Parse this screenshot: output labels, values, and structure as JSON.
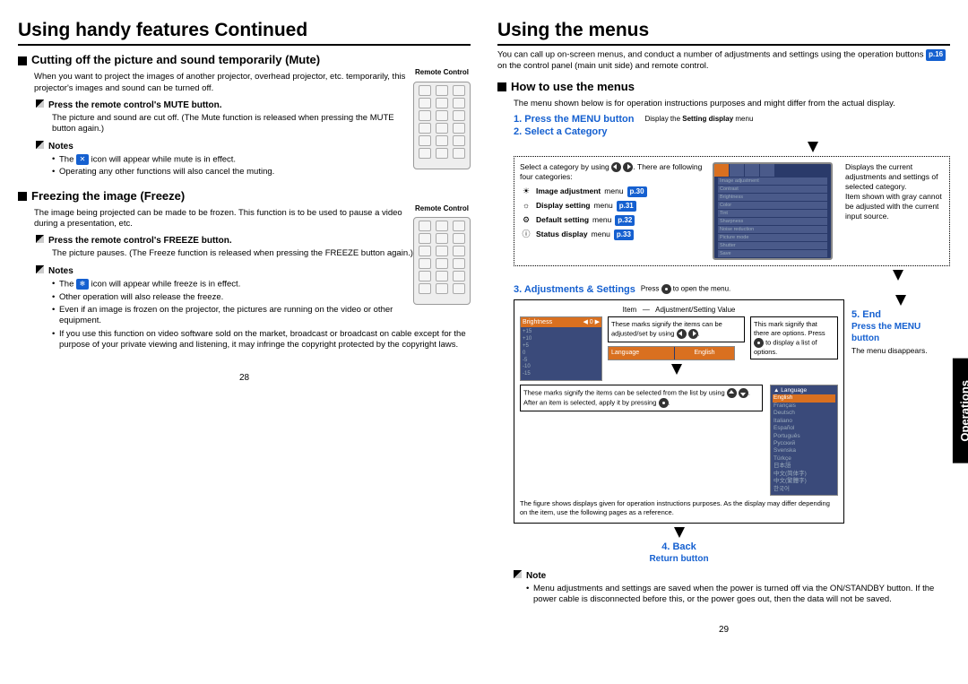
{
  "left": {
    "title": "Using handy features Continued",
    "mute": {
      "heading": "Cutting off the picture and sound temporarily (Mute)",
      "intro": "When you want to project the images of another projector, overhead projector, etc. temporarily, this projector's images and sound can be turned off.",
      "remote_label": "Remote Control",
      "step1": "Press the remote control's MUTE button.",
      "step1_desc": "The picture and sound are cut off. (The Mute function is released when pressing the MUTE button again.)",
      "notes_label": "Notes",
      "note1a": "The ",
      "note1b": " icon will appear while mute is in effect.",
      "note2": "Operating any other functions will also cancel the muting."
    },
    "freeze": {
      "heading": "Freezing the image (Freeze)",
      "intro": "The image being projected can be made to be frozen. This function is to be used to pause a video during a presentation, etc.",
      "remote_label": "Remote Control",
      "step1": "Press the remote control's FREEZE button.",
      "step1_desc": "The picture pauses. (The Freeze function is released when pressing the FREEZE button again.)",
      "notes_label": "Notes",
      "note1a": "The ",
      "note1b": " icon will appear while freeze is in effect.",
      "note2": "Other operation will also release the freeze.",
      "note3": "Even if an image is frozen on the projector, the pictures are running on the video or other equipment.",
      "note4": "If you use this function on video software sold on the market, broadcast or broadcast on cable except for the purpose of your private viewing and listening, it may infringe the copyright protected by the copyright laws."
    },
    "pagenum": "28"
  },
  "right": {
    "title": "Using the menus",
    "intro_a": "You can call up on-screen menus, and conduct a number of adjustments and settings using the operation buttons ",
    "intro_ref": "p.16",
    "intro_b": " on the control panel (main unit side) and remote control.",
    "howto_heading": "How to use the menus",
    "howto_intro": "The menu shown below is for operation instructions purposes and might differ from the actual display.",
    "step1": "1. Press the MENU button",
    "step1_note": "Display the Setting display menu",
    "step2": "2. Select a Category",
    "cat_intro_a": "Select a category by using ",
    "cat_intro_b": ". There are following four categories:",
    "cats": [
      {
        "name": "Image adjustment menu",
        "ref": "p.30"
      },
      {
        "name": "Display setting menu",
        "ref": "p.31"
      },
      {
        "name": "Default setting menu",
        "ref": "p.32"
      },
      {
        "name": "Status display menu",
        "ref": "p.33"
      }
    ],
    "side_desc": "Displays the current adjustments and settings of selected category.\nItem shown with gray cannot be adjusted with the current input source.",
    "menu_items": [
      "Image adjustment",
      "Contrast",
      "Brightness",
      "Color",
      "Tint",
      "Sharpness",
      "Noise reduction",
      "Picture mode",
      "Shutter",
      "Save"
    ],
    "step3": "3. Adjustments & Settings",
    "step3_note_a": "Press ",
    "step3_note_b": " to open the menu.",
    "item_label": "Item",
    "adjval_label": "Adjustment/Setting Value",
    "callout_marks_a": "These marks signify the items can be adjusted/set by using ",
    "callout_options_a": "This mark signify that there are options. Press ",
    "callout_options_b": " to display a list of options.",
    "callout_list_a": "These marks signify the items can be selected from the list by using ",
    "callout_list_b": ". After an item is selected, apply it by pressing ",
    "footnote": "The figure shows displays given for operation instructions purposes. As the display may differ depending on the item, use the following pages as a reference.",
    "languages": [
      "English",
      "Français",
      "Deutsch",
      "Italiano",
      "Español",
      "Português",
      "Русский",
      "Svenska",
      "Türkçe",
      "日本語",
      "中文(简体字)",
      "中文(繁體字)",
      "한국어"
    ],
    "brightness_label": "Brightness",
    "language_label": "Language",
    "lang_english": "English",
    "scale_vals": [
      "+15",
      "+10",
      "+5",
      "0",
      "-5",
      "-10",
      "-15"
    ],
    "step4": "4. Back",
    "step4_sub": "Return button",
    "step5": "5. End",
    "step5_sub": "Press the MENU button",
    "step5_desc": "The menu disappears.",
    "note_label": "Note",
    "final_note": "Menu adjustments and settings are saved when the power is turned off via the ON/STANDBY button. If the power cable is disconnected before this, or the power goes out, then the data will not be saved.",
    "pagenum": "29",
    "side_tab": "Operations"
  }
}
